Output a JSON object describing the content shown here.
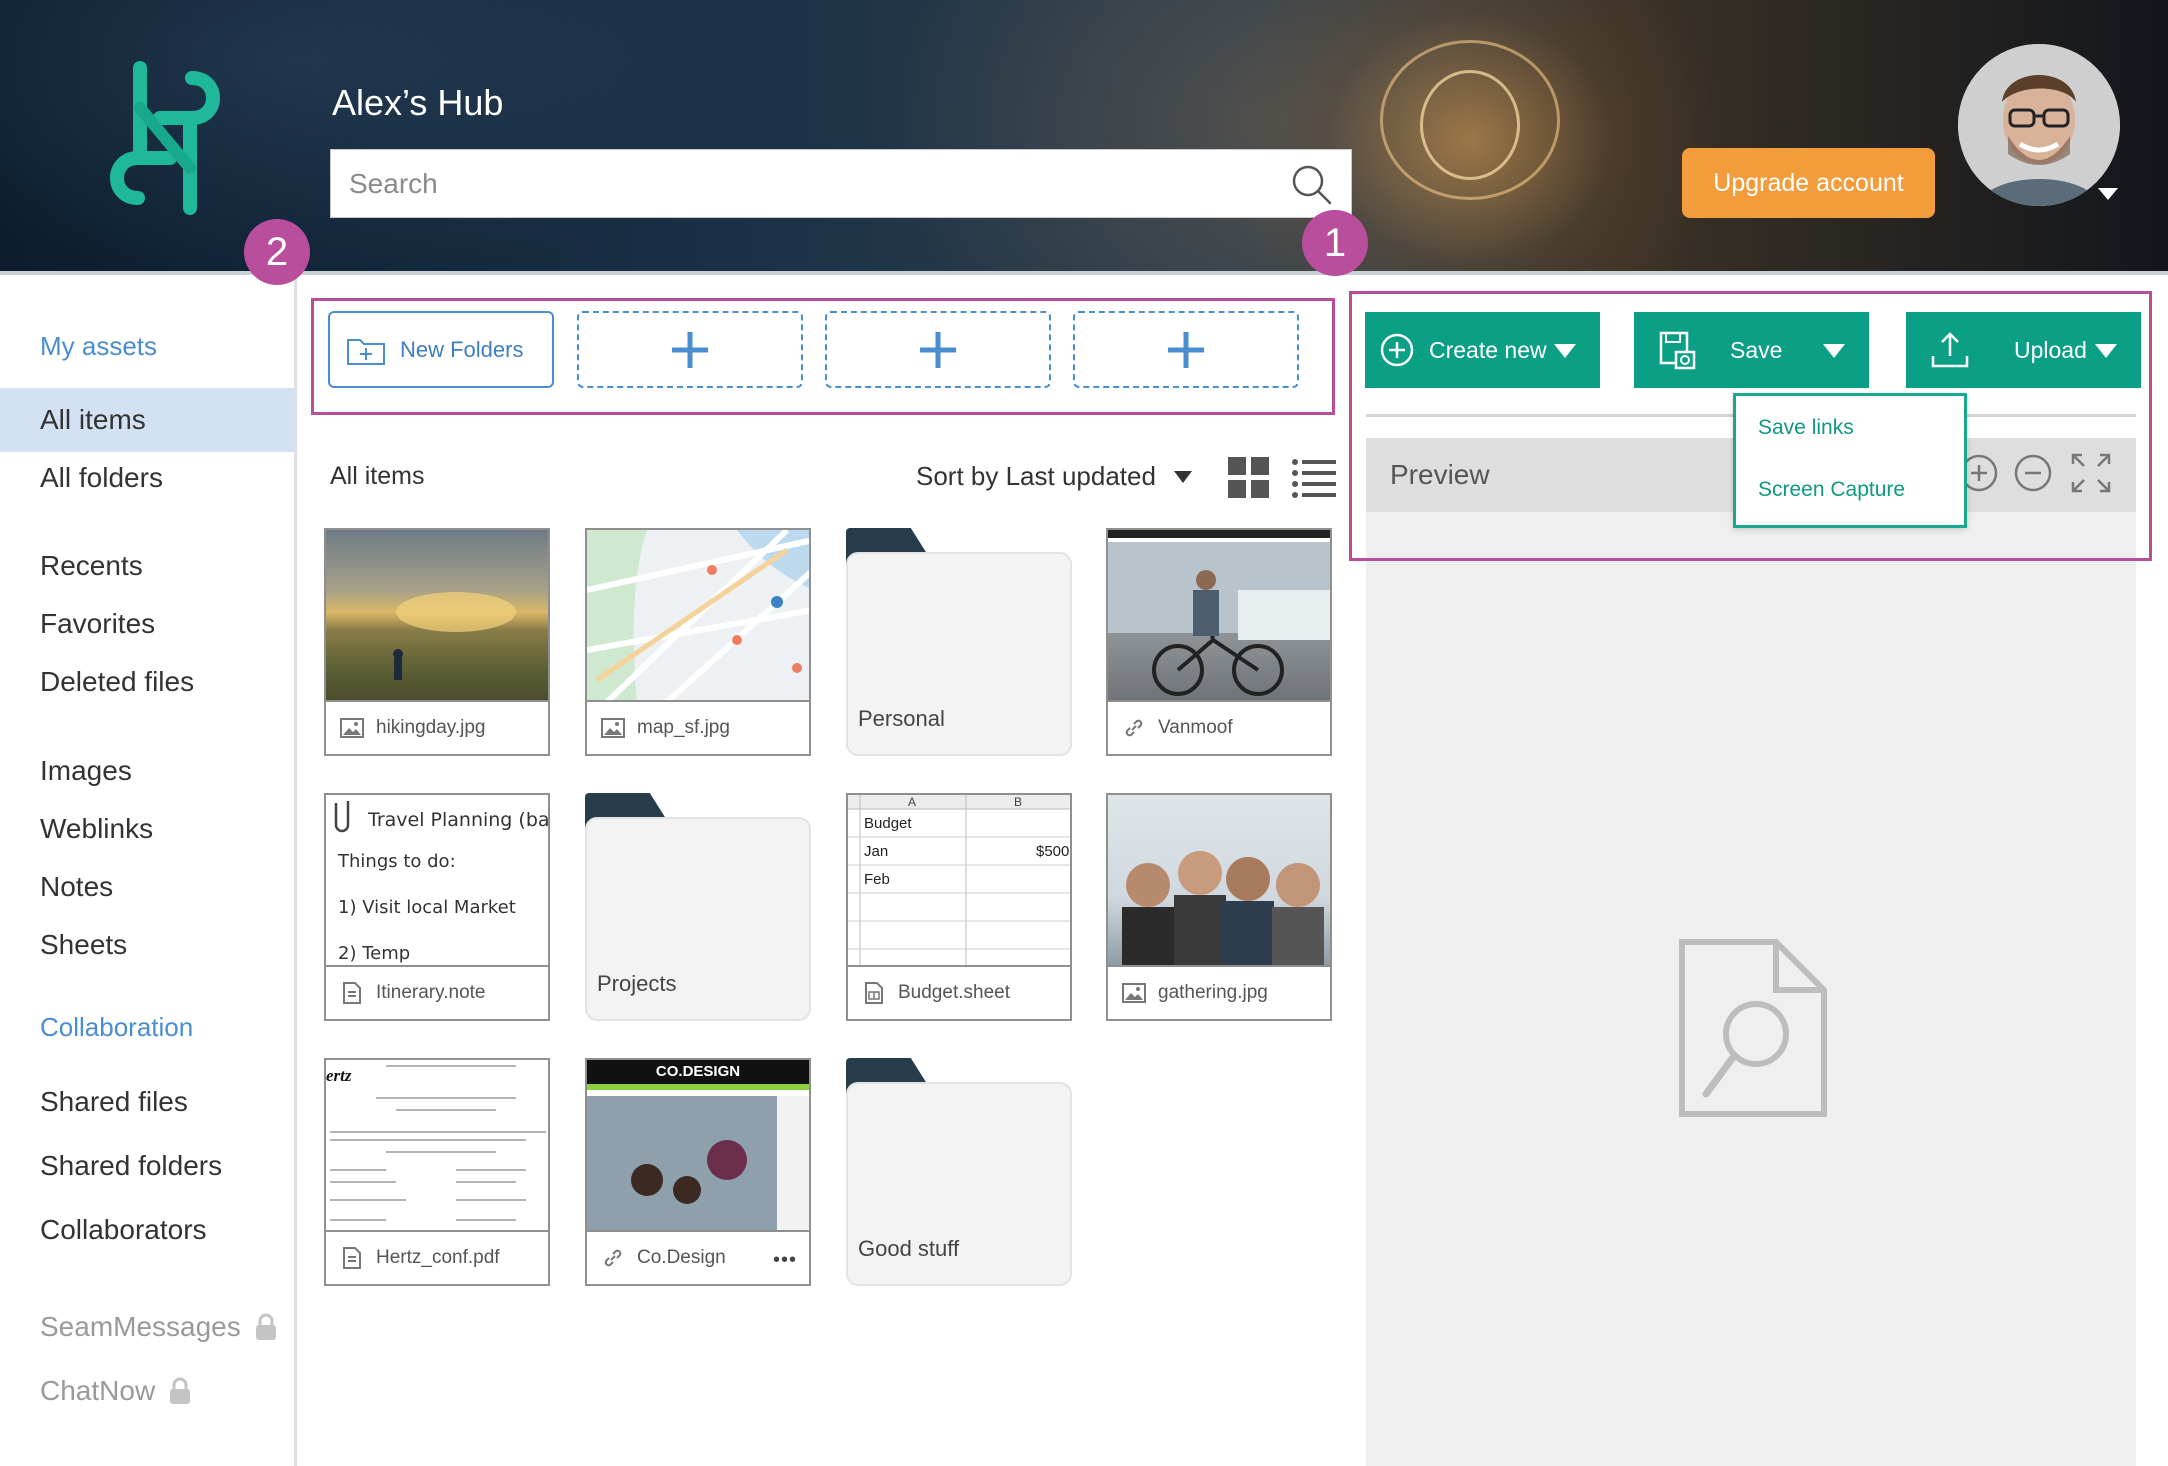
{
  "header": {
    "hub_title": "Alex’s Hub",
    "search_placeholder": "Search",
    "upgrade_label": "Upgrade account"
  },
  "badges": [
    "1",
    "2"
  ],
  "sidebar": {
    "my_assets": "My assets",
    "items": [
      {
        "label": "All items",
        "active": true
      },
      {
        "label": "All folders"
      },
      {
        "label": "Recents"
      },
      {
        "label": "Favorites"
      },
      {
        "label": "Deleted files"
      },
      {
        "label": "Images"
      },
      {
        "label": "Weblinks"
      },
      {
        "label": "Notes"
      },
      {
        "label": "Sheets"
      }
    ],
    "collaboration": "Collaboration",
    "collab_items": [
      {
        "label": "Shared files"
      },
      {
        "label": "Shared folders"
      },
      {
        "label": "Collaborators"
      }
    ],
    "locked_items": [
      {
        "label": "SeamMessages"
      },
      {
        "label": "ChatNow"
      }
    ]
  },
  "toolbar": {
    "new_folders_label": "New Folders",
    "add_slot_label": "+"
  },
  "items_header": {
    "title": "All items",
    "sort_label": "Sort by Last updated"
  },
  "items": [
    {
      "name": "hikingday.jpg",
      "kind": "image"
    },
    {
      "name": "map_sf.jpg",
      "kind": "image"
    },
    {
      "name": "Personal",
      "kind": "folder"
    },
    {
      "name": "Vanmoof",
      "kind": "weblink"
    },
    {
      "name": "Itinerary.note",
      "kind": "note"
    },
    {
      "name": "Projects",
      "kind": "folder"
    },
    {
      "name": "Budget.sheet",
      "kind": "sheet"
    },
    {
      "name": "gathering.jpg",
      "kind": "image"
    },
    {
      "name": "Hertz_conf.pdf",
      "kind": "pdf"
    },
    {
      "name": "Co.Design",
      "kind": "weblink"
    },
    {
      "name": "Good stuff",
      "kind": "folder"
    }
  ],
  "note_preview": {
    "title": "Travel Planning (ban",
    "lines": [
      "Things to do:",
      "1) Visit local Market",
      "2) Temp"
    ]
  },
  "sheet_preview": {
    "col_a": "A",
    "col_b": "B",
    "rows": [
      {
        "a": "Budget",
        "b": ""
      },
      {
        "a": "Jan",
        "b": "$500"
      },
      {
        "a": "Feb",
        "b": ""
      }
    ]
  },
  "codesign_preview": {
    "masthead": "CO.DESIGN"
  },
  "hertz_preview": {
    "brand": "ertz"
  },
  "more_label": "•••",
  "actions": {
    "create_new": "Create new",
    "save": "Save",
    "upload": "Upload",
    "save_menu": [
      "Save links",
      "Screen Capture"
    ]
  },
  "preview": {
    "title": "Preview"
  },
  "colors": {
    "accent_teal": "#0b9f85",
    "accent_orange": "#f29c3b",
    "annotation_magenta": "#b84e9c",
    "link_blue": "#4a8ed1"
  }
}
